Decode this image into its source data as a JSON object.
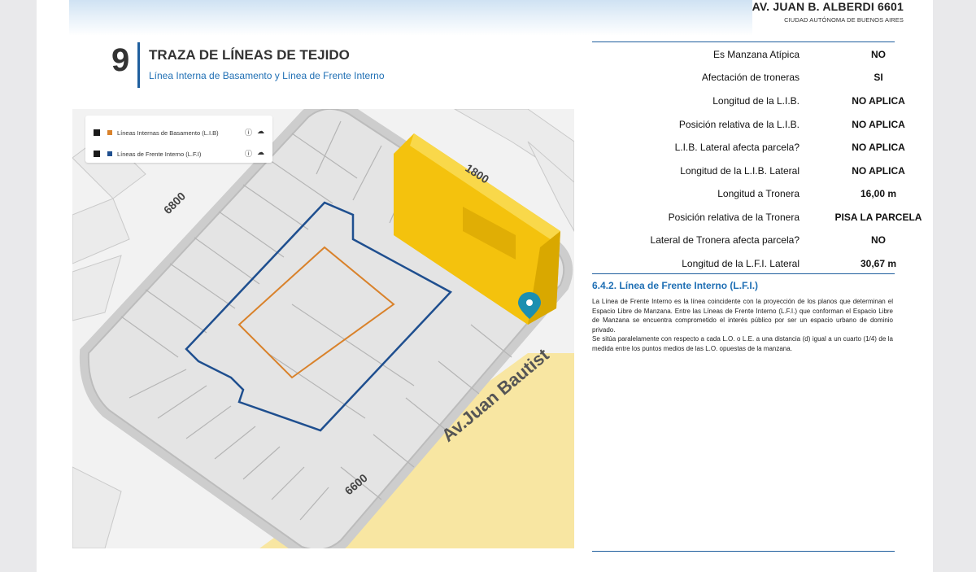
{
  "header": {
    "address": "AV. JUAN B. ALBERDI 6601",
    "city": "CIUDAD AUTÓNOMA DE BUENOS AIRES"
  },
  "section": {
    "number": "9",
    "title": "TRAZA DE LÍNEAS DE TEJIDO",
    "subtitle": "Línea Interna de Basamento y Línea de Frente Interno"
  },
  "map": {
    "legend": [
      {
        "label": "Líneas Internas de Basamento (L.I.B)",
        "color": "#d9822b"
      },
      {
        "label": "Líneas de Frente Interno (L.F.I)",
        "color": "#1f4f8f"
      }
    ],
    "street_labels": [
      "1800",
      "6800",
      "6600",
      "Av.Juan Bautist"
    ],
    "colors": {
      "street": "#cdcdcd",
      "avenue": "#f8e6a2",
      "building": "#f4c20d",
      "lib_line": "#d9822b",
      "lfi_line": "#1f4f8f",
      "marker": "#1c8fb0"
    }
  },
  "table": {
    "rows": [
      {
        "label": "Es Manzana Atípica",
        "value": "NO"
      },
      {
        "label": "Afectación de troneras",
        "value": "SI"
      },
      {
        "label": "Longitud de la L.I.B.",
        "value": "NO APLICA"
      },
      {
        "label": "Posición relativa de la L.I.B.",
        "value": "NO APLICA"
      },
      {
        "label": "L.I.B. Lateral afecta parcela?",
        "value": "NO APLICA"
      },
      {
        "label": "Longitud de la L.I.B. Lateral",
        "value": "NO APLICA"
      },
      {
        "label": "Longitud a Tronera",
        "value": "16,00 m"
      },
      {
        "label": "Posición relativa de la Tronera",
        "value": "PISA LA PARCELA"
      },
      {
        "label": "Lateral de Tronera afecta parcela?",
        "value": "NO"
      },
      {
        "label": "Longitud de la L.F.I. Lateral",
        "value": "30,67 m"
      }
    ]
  },
  "lfi_section": {
    "heading": "6.4.2. Línea de Frente Interno (L.F.I.)",
    "paragraph1": "La Línea de Frente Interno es la línea coincidente con la proyección de los planos que determinan el Espacio Libre de Manzana. Entre las Líneas de Frente Interno (L.F.I.) que conforman el Espacio Libre de Manzana se encuentra comprometido el interés público por ser un espacio urbano de dominio privado.",
    "paragraph2": "Se sitúa paralelamente con respecto a cada L.O. o L.E. a una distancia (d) igual a un cuarto (1/4) de la medida entre los puntos medios de las L.O. opuestas de la manzana."
  }
}
